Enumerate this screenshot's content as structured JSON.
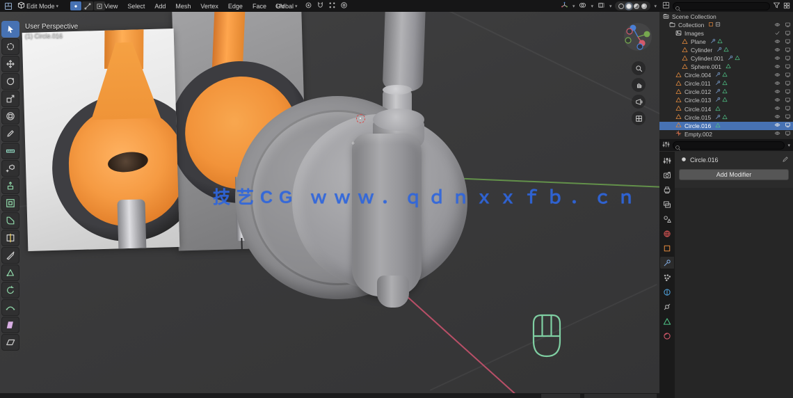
{
  "watermark": {
    "text": "技艺CG ｗｗｗ．ｑｄｎｘｘｆｂ．ｃｎ",
    "color": "#2f66dd"
  },
  "viewport": {
    "header": {
      "editor_icon": "editor-grid-icon",
      "mode_label": "Edit Mode",
      "select_modes": [
        "vertex",
        "edge",
        "face"
      ],
      "active_select_mode": "vertex",
      "menus": [
        "View",
        "Select",
        "Add",
        "Mesh",
        "Vertex",
        "Edge",
        "Face",
        "UV"
      ],
      "orientation": "Global",
      "center_icons": [
        "pivot-icon",
        "magnet-icon",
        "snap-grid-icon",
        "proportional-icon"
      ],
      "right_icons": [
        "gizmo-toggle-icon",
        "overlays-toggle-icon",
        "xray-toggle-icon"
      ],
      "shading_modes": [
        "wireframe",
        "solid",
        "material",
        "rendered"
      ],
      "active_shading": "solid"
    },
    "overlay": {
      "line1": "User Perspective",
      "line2": "(1) Circle.016"
    },
    "axis_colors": {
      "x": "#cf5470",
      "y": "#6ea84f"
    },
    "side_icons": [
      "magnifier-icon",
      "hand-icon",
      "camera-icon",
      "grid-icon"
    ],
    "screencast_mouse_color": "#7fcfa2"
  },
  "toolbar": {
    "tools": [
      {
        "name": "select-box",
        "icon": "cursor",
        "color": "#ffffff",
        "active": true
      },
      {
        "name": "cursor",
        "icon": "lasso",
        "color": "#cccccc"
      },
      {
        "name": "move",
        "icon": "move",
        "color": "#cccccc"
      },
      {
        "name": "rotate",
        "icon": "rotate",
        "color": "#cccccc"
      },
      {
        "name": "scale",
        "icon": "scale",
        "color": "#cccccc"
      },
      {
        "name": "transform",
        "icon": "transform",
        "color": "#cccccc"
      },
      {
        "name": "annotate",
        "icon": "annotate",
        "color": "#cccccc"
      },
      {
        "name": "measure",
        "icon": "measure",
        "color": "#8fd6c0"
      },
      {
        "name": "add-cube",
        "icon": "addcube",
        "color": "#cccccc"
      },
      {
        "name": "extrude-region",
        "icon": "extrude",
        "color": "#8fd6a8"
      },
      {
        "name": "inset-faces",
        "icon": "inset",
        "color": "#8fd6a8"
      },
      {
        "name": "bevel",
        "icon": "bevel",
        "color": "#8fd6a8"
      },
      {
        "name": "loop-cut",
        "icon": "loopcut",
        "color": "#cccccc"
      },
      {
        "name": "knife",
        "icon": "knife",
        "color": "#cccccc"
      },
      {
        "name": "poly-build",
        "icon": "polybuild",
        "color": "#8fd6a8"
      },
      {
        "name": "spin",
        "icon": "spin",
        "color": "#8fd6a8"
      },
      {
        "name": "smooth",
        "icon": "smooth",
        "color": "#8fd6a8"
      },
      {
        "name": "rip-region",
        "icon": "rip",
        "color": "#d8aee4"
      },
      {
        "name": "shear",
        "icon": "shear",
        "color": "#cccccc"
      }
    ]
  },
  "outliner": {
    "rows": [
      {
        "name": "Scene Collection",
        "icon": "scene-collection",
        "depth": 0,
        "badges": [],
        "vis": []
      },
      {
        "name": "Collection",
        "icon": "collection",
        "depth": 1,
        "badges": [
          "object-badge",
          "exclude-badge"
        ],
        "vis": [
          "eye",
          "screen"
        ]
      },
      {
        "name": "Images",
        "icon": "image",
        "depth": 2,
        "badges": [],
        "vis": [
          "check",
          "screen"
        ]
      },
      {
        "name": "Plane",
        "icon": "mesh",
        "depth": 3,
        "badges": [
          "wrench",
          "data"
        ],
        "vis": [
          "eye",
          "screen"
        ]
      },
      {
        "name": "Cylinder",
        "icon": "mesh",
        "depth": 3,
        "badges": [
          "wrench",
          "data"
        ],
        "vis": [
          "eye",
          "screen"
        ]
      },
      {
        "name": "Cylinder.001",
        "icon": "mesh",
        "depth": 3,
        "badges": [
          "wrench",
          "data"
        ],
        "vis": [
          "eye",
          "screen"
        ]
      },
      {
        "name": "Sphere.001",
        "icon": "mesh",
        "depth": 3,
        "badges": [
          "data"
        ],
        "vis": [
          "eye",
          "screen"
        ]
      },
      {
        "name": "Circle.004",
        "icon": "mesh",
        "depth": 2,
        "badges": [
          "wrench",
          "data"
        ],
        "vis": [
          "eye",
          "screen"
        ]
      },
      {
        "name": "Circle.011",
        "icon": "mesh",
        "depth": 2,
        "badges": [
          "wrench",
          "data"
        ],
        "vis": [
          "eye",
          "screen"
        ]
      },
      {
        "name": "Circle.012",
        "icon": "mesh",
        "depth": 2,
        "badges": [
          "wrench",
          "data"
        ],
        "vis": [
          "eye",
          "screen"
        ]
      },
      {
        "name": "Circle.013",
        "icon": "mesh",
        "depth": 2,
        "badges": [
          "wrench",
          "data"
        ],
        "vis": [
          "eye",
          "screen"
        ]
      },
      {
        "name": "Circle.014",
        "icon": "mesh",
        "depth": 2,
        "badges": [
          "data"
        ],
        "vis": [
          "eye",
          "screen"
        ]
      },
      {
        "name": "Circle.015",
        "icon": "mesh",
        "depth": 2,
        "badges": [
          "wrench",
          "data"
        ],
        "vis": [
          "eye",
          "screen"
        ]
      },
      {
        "name": "Circle.016",
        "icon": "mesh",
        "depth": 2,
        "selected": true,
        "badges": [
          "data"
        ],
        "vis": [
          "eye",
          "screen"
        ]
      },
      {
        "name": "Empty.002",
        "icon": "empty-axes",
        "depth": 2,
        "badges": [],
        "vis": [
          "eye",
          "screen"
        ]
      }
    ]
  },
  "properties": {
    "tabs": [
      "tool",
      "render",
      "output",
      "view-layer",
      "scene",
      "world",
      "object",
      "modifiers",
      "particles",
      "physics",
      "constraints",
      "object-data",
      "material"
    ],
    "active_tab": "modifiers",
    "object_name": "Circle.016",
    "add_modifier_label": "Add Modifier"
  }
}
